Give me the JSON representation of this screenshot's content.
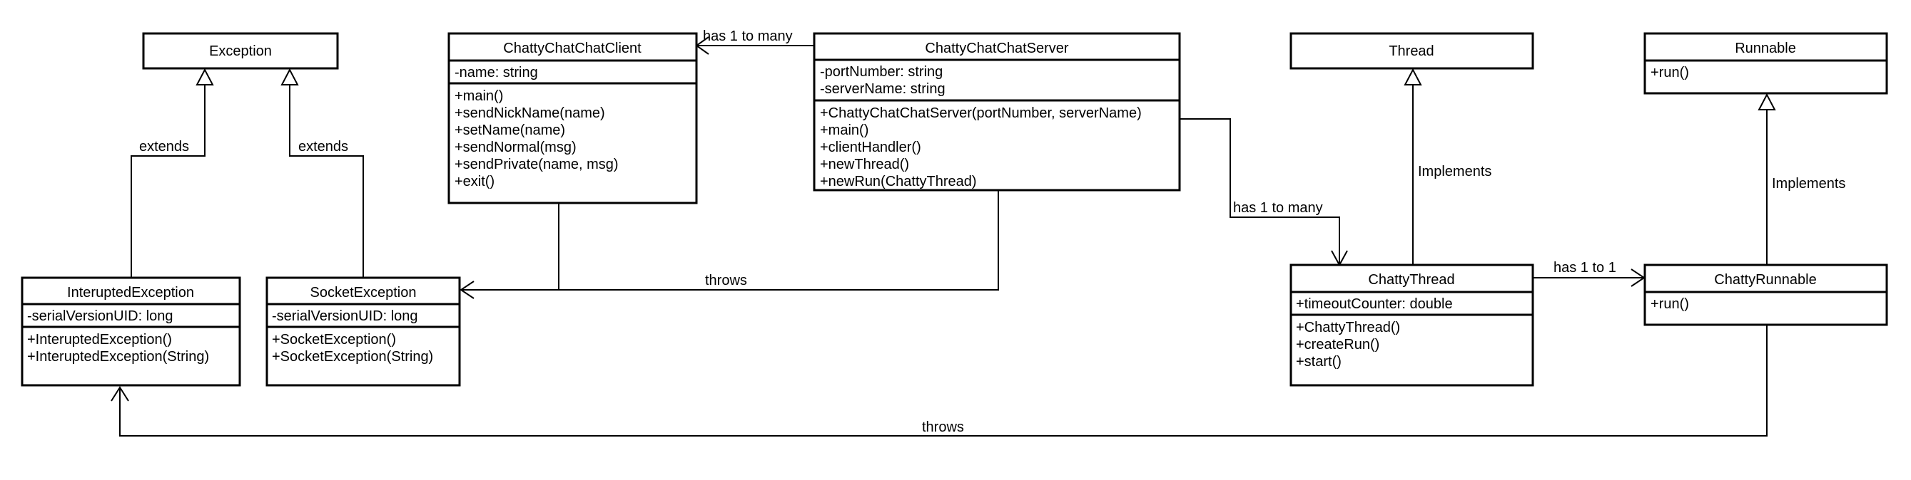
{
  "classes": {
    "exception": {
      "name": "Exception"
    },
    "client": {
      "name": "ChattyChatChatClient",
      "attributes": [
        "-name: string"
      ],
      "methods": [
        "+main()",
        "+sendNickName(name)",
        "+setName(name)",
        "+sendNormal(msg)",
        "+sendPrivate(name, msg)",
        "+exit()"
      ]
    },
    "server": {
      "name": "ChattyChatChatServer",
      "attributes": [
        "-portNumber: string",
        "-serverName: string"
      ],
      "methods": [
        "+ChattyChatChatServer(portNumber, serverName)",
        "+main()",
        "+clientHandler()",
        "+newThread()",
        "+newRun(ChattyThread)"
      ]
    },
    "thread": {
      "name": "Thread"
    },
    "runnable": {
      "name": "Runnable",
      "methods": [
        "+run()"
      ]
    },
    "interupted": {
      "name": "InteruptedException",
      "attributes": [
        "-serialVersionUID: long"
      ],
      "methods": [
        "+InteruptedException()",
        "+InteruptedException(String)"
      ]
    },
    "socket": {
      "name": "SocketException",
      "attributes": [
        "-serialVersionUID: long"
      ],
      "methods": [
        "+SocketException()",
        "+SocketException(String)"
      ]
    },
    "chattyThread": {
      "name": "ChattyThread",
      "attributes": [
        "+timeoutCounter: double"
      ],
      "methods": [
        "+ChattyThread()",
        "+createRun()",
        "+start()"
      ]
    },
    "chattyRunnable": {
      "name": "ChattyRunnable",
      "methods": [
        "+run()"
      ]
    }
  },
  "relations": {
    "server_client": "has 1 to many",
    "server_thread": "has 1 to many",
    "throws_socket": "throws",
    "extends_interupted": "extends",
    "extends_socket": "extends",
    "implements_thread": "Implements",
    "implements_runnable": "Implements",
    "thread_runnable": "has 1 to 1",
    "throws_interupted": "throws"
  }
}
